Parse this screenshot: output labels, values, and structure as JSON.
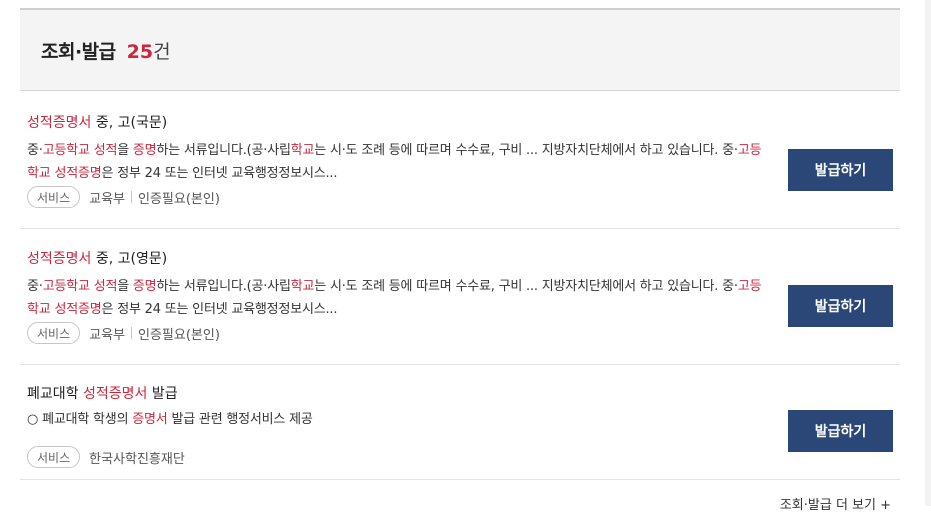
{
  "header": {
    "title": "조회·발급",
    "count": "25",
    "count_unit": "건"
  },
  "results": [
    {
      "title_highlight": "성적증명서",
      "title_rest": " 중, 고(국문)",
      "desc": {
        "p1": "중·",
        "h1": "고등학교",
        "p2": " ",
        "h2": "성적",
        "p3": "을 ",
        "h3": "증명",
        "p4": "하는 서류입니다.(공·사립",
        "h4": "학교",
        "p5": "는 시·도 조례 등에 따르며 수수료, 구비 ... 지방자치단체에서 하고 있습니다. 중·",
        "h5": "고등학교",
        "p6": " ",
        "h6": "성적증명",
        "p7": "은 정부 24 또는 인터넷 교육행정정보시스..."
      },
      "tag": "서비스",
      "org": "교육부",
      "auth": "인증필요(본인)",
      "button": "발급하기"
    },
    {
      "title_highlight": "성적증명서",
      "title_rest": " 중, 고(영문)",
      "desc": {
        "p1": "중·",
        "h1": "고등학교",
        "p2": " ",
        "h2": "성적",
        "p3": "을 ",
        "h3": "증명",
        "p4": "하는 서류입니다.(공·사립",
        "h4": "학교",
        "p5": "는 시·도 조례 등에 따르며 수수료, 구비 ... 지방자치단체에서 하고 있습니다. 중·",
        "h5": "고등학교",
        "p6": " ",
        "h6": "성적증명",
        "p7": "은 정부 24 또는 인터넷 교육행정정보시스..."
      },
      "tag": "서비스",
      "org": "교육부",
      "auth": "인증필요(본인)",
      "button": "발급하기"
    },
    {
      "title_pre": "폐교대학 ",
      "title_highlight": "성적증명서",
      "title_rest": " 발급",
      "desc": {
        "p1": "○ 폐교대학 학생의 ",
        "h1": "증명서",
        "p2": " 발급 관련 행정서비스 제공"
      },
      "tag": "서비스",
      "org": "한국사학진흥재단",
      "button": "발급하기"
    }
  ],
  "more_link": "조회·발급 더 보기 +",
  "colors": {
    "highlight": "#c8283e",
    "button_bg": "#2a4777",
    "count": "#d0243c"
  }
}
